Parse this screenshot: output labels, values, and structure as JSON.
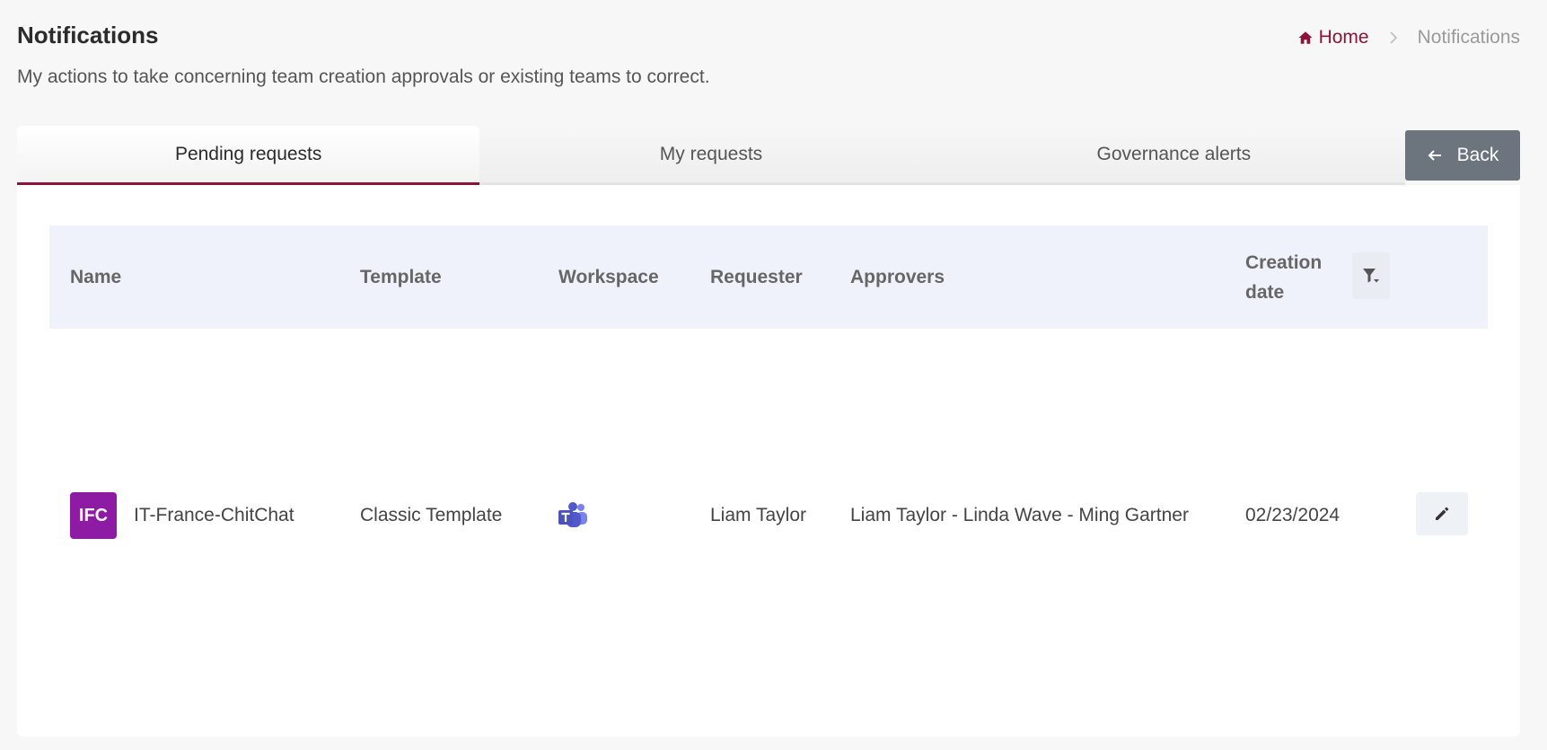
{
  "header": {
    "title": "Notifications",
    "subtitle": "My actions to take concerning team creation approvals or existing teams to correct."
  },
  "breadcrumb": {
    "home": "Home",
    "current": "Notifications"
  },
  "tabs": [
    {
      "label": "Pending requests",
      "active": true
    },
    {
      "label": "My requests",
      "active": false
    },
    {
      "label": "Governance alerts",
      "active": false
    }
  ],
  "back_button": {
    "label": "Back"
  },
  "table": {
    "columns": {
      "name": "Name",
      "template": "Template",
      "workspace": "Workspace",
      "requester": "Requester",
      "approvers": "Approvers",
      "creation_date": "Creation date"
    },
    "rows": [
      {
        "avatar_initials": "IFC",
        "avatar_color": "#8e1ba3",
        "name": "IT-France-ChitChat",
        "template": "Classic Template",
        "workspace_icon": "microsoft-teams-icon",
        "requester": "Liam Taylor",
        "approvers": "Liam Taylor - Linda Wave - Ming Gartner",
        "creation_date": "02/23/2024"
      }
    ]
  },
  "colors": {
    "accent": "#8a1538",
    "back_button": "#6c757d",
    "table_header": "#eff2fa",
    "avatar": "#8e1ba3",
    "teams": "#5059c9"
  }
}
